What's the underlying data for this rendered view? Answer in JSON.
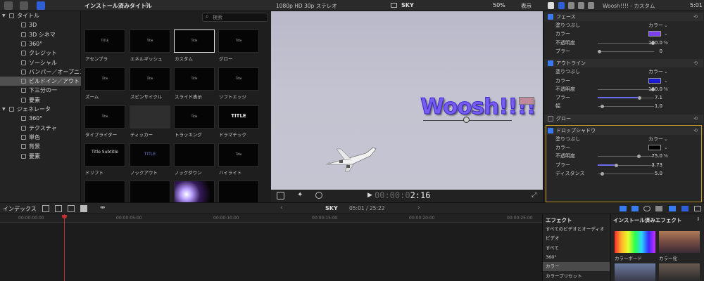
{
  "toolbar": {
    "library_title": "インストール済みタイトル",
    "format": "1080p HD 30p ステレオ",
    "clip_name": "SKY",
    "zoom": "50%",
    "view_menu": "表示",
    "inspector_title": "Woosh!!!! - カスタム",
    "time_right": "5:01"
  },
  "sidebar": {
    "items": [
      {
        "label": "タイトル",
        "level": 0,
        "expanded": true
      },
      {
        "label": "3D",
        "level": 1
      },
      {
        "label": "3D シネマ",
        "level": 1
      },
      {
        "label": "360°",
        "level": 1
      },
      {
        "label": "クレジット",
        "level": 1
      },
      {
        "label": "ソーシャル",
        "level": 1
      },
      {
        "label": "バンパー／オープニング",
        "level": 1
      },
      {
        "label": "ビルドイン／アウト",
        "level": 1,
        "selected": true
      },
      {
        "label": "下三分の一",
        "level": 1
      },
      {
        "label": "要素",
        "level": 1
      },
      {
        "label": "ジェネレータ",
        "level": 0,
        "expanded": true
      },
      {
        "label": "360°",
        "level": 1
      },
      {
        "label": "テクスチャ",
        "level": 1
      },
      {
        "label": "単色",
        "level": 1
      },
      {
        "label": "背景",
        "level": 1
      },
      {
        "label": "要素",
        "level": 1
      }
    ]
  },
  "browser": {
    "search_placeholder": "検索",
    "thumbs": [
      {
        "label": "アセンブラ",
        "inner": "TITLE"
      },
      {
        "label": "エネルギッシュ",
        "inner": "Title"
      },
      {
        "label": "カスタム",
        "inner": "Title",
        "selected": true
      },
      {
        "label": "グロー",
        "inner": "Title"
      },
      {
        "label": "ズーム",
        "inner": "Title"
      },
      {
        "label": "スピンサイクル",
        "inner": "Title"
      },
      {
        "label": "スライド表示",
        "inner": "Title"
      },
      {
        "label": "ソフトエッジ",
        "inner": "Title"
      },
      {
        "label": "タイプライター",
        "inner": "Title"
      },
      {
        "label": "ティッカー",
        "inner": ""
      },
      {
        "label": "トラッキング",
        "inner": "Title"
      },
      {
        "label": "ドラマチック",
        "inner": "TITLE"
      },
      {
        "label": "ドリフト",
        "inner": "Title Subtitle"
      },
      {
        "label": "ノックアウト",
        "inner": "TITLE"
      },
      {
        "label": "ノックダウン",
        "inner": ""
      },
      {
        "label": "ハイライト",
        "inner": "Title"
      },
      {
        "label": "",
        "inner": ""
      },
      {
        "label": "",
        "inner": ""
      },
      {
        "label": "",
        "inner": ""
      },
      {
        "label": "",
        "inner": ""
      }
    ]
  },
  "viewer": {
    "title_text": "Woosh!!!!",
    "title_color": "#7b5cf0",
    "timecode": "00:00:02:16",
    "timecode_dim": "00:00:0",
    "timecode_bright": "2:16"
  },
  "inspector": {
    "face": {
      "header": "フェース",
      "fill_label": "塗りつぶし",
      "fill_value": "カラー",
      "color_label": "カラー",
      "color": "#7b3ff0",
      "opacity_label": "不透明度",
      "opacity": "100.0",
      "blur_label": "ブラー",
      "blur": "0"
    },
    "outline": {
      "header": "アウトライン",
      "fill_label": "塗りつぶし",
      "fill_value": "カラー",
      "color_label": "カラー",
      "color": "#1a1acf",
      "opacity_label": "不透明度",
      "opacity": "100.0",
      "blur_label": "ブラー",
      "blur": "7.1",
      "width_label": "幅",
      "width": "1.0"
    },
    "glow": {
      "header": "グロー"
    },
    "shadow": {
      "header": "ドロップシャドウ",
      "fill_label": "塗りつぶし",
      "fill_value": "カラー",
      "color_label": "カラー",
      "color": "#000000",
      "opacity_label": "不透明度",
      "opacity": "75.0",
      "blur_label": "ブラー",
      "blur": "3.73",
      "distance_label": "ディスタンス",
      "distance": "5.0"
    },
    "percent": "%"
  },
  "timeline": {
    "index_label": "インデックス",
    "project_name": "SKY",
    "duration": "05:01 / 25:22",
    "ruler": [
      "00:00:00:00",
      "00:00:05:00",
      "00:00:10:00",
      "00:00:15:00",
      "00:00:20:00",
      "00:00:25:00"
    ]
  },
  "effects": {
    "header": "エフェクト",
    "installed_header": "インストール済みエフェクト",
    "items": [
      {
        "label": "すべてのビデオとオーディオ"
      },
      {
        "label": "ビデオ"
      },
      {
        "label": "すべて"
      },
      {
        "label": "360°"
      },
      {
        "label": "カラー",
        "selected": true
      },
      {
        "label": "カラープリセット"
      }
    ],
    "thumbs": [
      {
        "label": "カラーボード"
      },
      {
        "label": "カラー化"
      }
    ]
  }
}
